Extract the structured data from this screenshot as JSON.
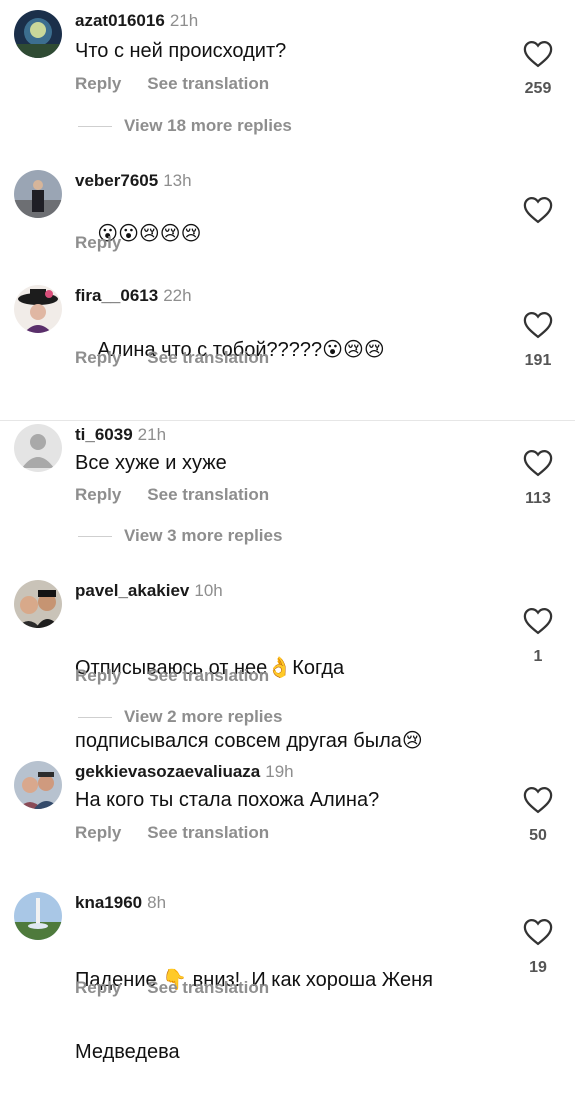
{
  "colors": {
    "muted": "#8e8e8e",
    "text": "#111111",
    "count": "#555555"
  },
  "comments": [
    {
      "username": "azat016016",
      "time": "21h",
      "text": "Что с ней происходит?",
      "reply_label": "Reply",
      "translate_label": "See translation",
      "likes": "259",
      "more_replies": "View 18 more replies"
    },
    {
      "username": "veber7605",
      "time": "13h",
      "text": "",
      "emoji": "😮😮😢😢😢",
      "reply_label": "Reply"
    },
    {
      "username": "fira__0613",
      "time": "22h",
      "text": "Алина что с тобой?????",
      "emoji": "😮😢😢",
      "reply_label": "Reply",
      "translate_label": "See translation",
      "likes": "191"
    },
    {
      "username": "ti_6039",
      "time": "21h",
      "text": "Все хуже и хуже",
      "reply_label": "Reply",
      "translate_label": "See translation",
      "likes": "113",
      "more_replies": "View 3 more replies"
    },
    {
      "username": "pavel_akakiev",
      "time": "10h",
      "line1": "Отписываюсь от нее",
      "emoji_mid": "👌",
      "line1b": "Когда",
      "line2": "подписывался совсем другая была",
      "emoji_end": "😢",
      "reply_label": "Reply",
      "translate_label": "See translation",
      "likes": "1",
      "more_replies": "View 2 more replies"
    },
    {
      "username": "gekkievasozaevaliuaza",
      "time": "19h",
      "text": "На кого ты стала похожа Алина?",
      "reply_label": "Reply",
      "translate_label": "See translation",
      "likes": "50"
    },
    {
      "username": "kna1960",
      "time": "8h",
      "line1a": "Падение",
      "emoji_mid": "👇",
      "line1b": "вниз!  И как хороша Женя",
      "line2": "Медведева",
      "reply_label": "Reply",
      "translate_label": "See translation",
      "likes": "19"
    }
  ]
}
